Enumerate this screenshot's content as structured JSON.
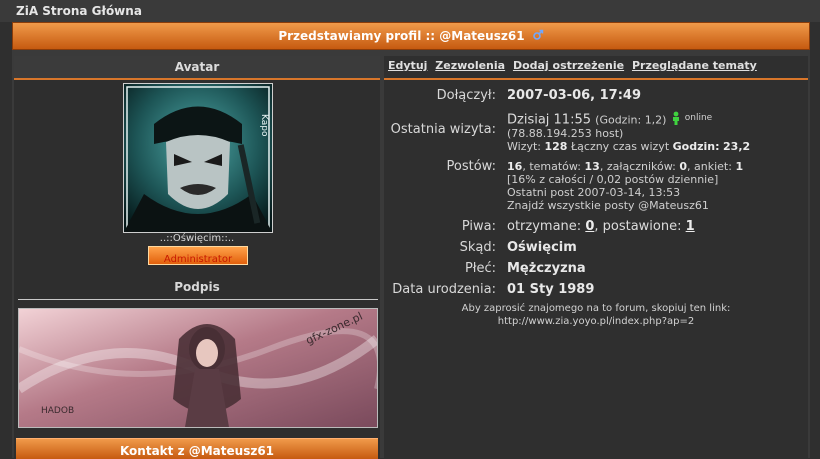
{
  "top": {
    "site_title": "ZiA Strona Główna"
  },
  "header": {
    "title": "Przedstawiamy profil :: @Mateusz61"
  },
  "left": {
    "avatar_heading": "Avatar",
    "avatar_text": "Kapo",
    "location": "..::Oświęcim::..",
    "rank": "Administrator",
    "signature_heading": "Podpis",
    "signature_text": "gfx-zone.pl",
    "signature_corner": "HADOB",
    "contact_heading": "Kontakt z @Mateusz61"
  },
  "links": [
    "Edytuj",
    "Zezwolenia",
    "Dodaj ostrzeżenie",
    "Przeglądane tematy"
  ],
  "profile": {
    "joined_label": "Dołączył:",
    "joined_value": "2007-03-06, 17:49",
    "last_visit_label": "Ostatnia wizyta:",
    "last_visit_value": "Dzisiaj 11:55",
    "last_visit_hours": "(Godzin: 1,2)",
    "online_label": "online",
    "last_visit_host": "(78.88.194.253  host)",
    "visits_label": "Wizyt:",
    "visits_value": "128",
    "total_time_label": "Łączny czas wizyt",
    "hours_label": "Godzin:",
    "hours_value": "23,2",
    "posts_label": "Postów:",
    "posts_value": "16",
    "topics_label": "tematów:",
    "topics_value": "13",
    "attachments_label": "załączników:",
    "attachments_value": "0",
    "polls_label": "ankiet:",
    "polls_value": "1",
    "posts_percent": "[16% z całości / 0,02 postów dziennie]",
    "last_post": "Ostatni post 2007-03-14, 13:53",
    "find_posts": "Znajdź wszystkie posty @Mateusz61",
    "beer_label": "Piwa:",
    "beer_received_label": "otrzymane:",
    "beer_received": "0",
    "beer_given_label": "postawione:",
    "beer_given": "1",
    "from_label": "Skąd:",
    "from_value": "Oświęcim",
    "gender_label": "Płeć:",
    "gender_value": "Mężczyzna",
    "birth_label": "Data urodzenia:",
    "birth_value": "01 Sty 1989",
    "invite_line1": "Aby zaprosić znajomego na to forum, skopiuj ten link:",
    "invite_line2": "http://www.zia.yoyo.pl/index.php?ap=2"
  },
  "colors": {
    "accent": "#d8762a",
    "header_gradient_top": "#f09a4a",
    "header_gradient_bottom": "#c65a10",
    "rank_text": "#c81a00"
  }
}
